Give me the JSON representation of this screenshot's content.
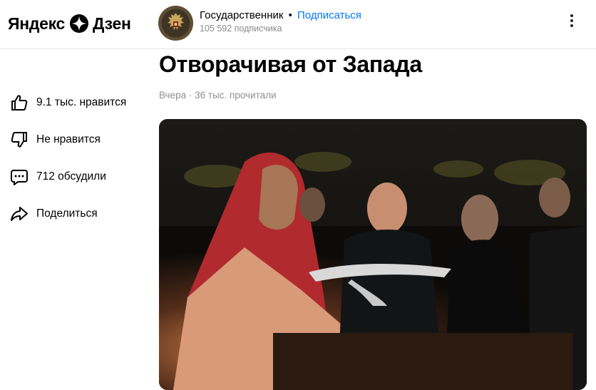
{
  "header": {
    "logo_text_left": "Яндекс",
    "logo_text_right": "Дзен",
    "channel_name": "Государственник",
    "separator": "•",
    "subscribe_label": "Подписаться",
    "subscribers": "105 592 подписчика"
  },
  "article": {
    "title": "Отворачивая от Запада",
    "meta": "Вчера · 36 тыс. прочитали"
  },
  "actions": [
    {
      "label": "9.1 тыс. нравится",
      "icon": "thumbs-up-icon"
    },
    {
      "label": "Не нравится",
      "icon": "thumbs-down-icon"
    },
    {
      "label": "712 обсудили",
      "icon": "comment-icon"
    },
    {
      "label": "Поделиться",
      "icon": "share-icon"
    }
  ],
  "colors": {
    "accent": "#0077ff",
    "muted": "#8f8f8f"
  }
}
